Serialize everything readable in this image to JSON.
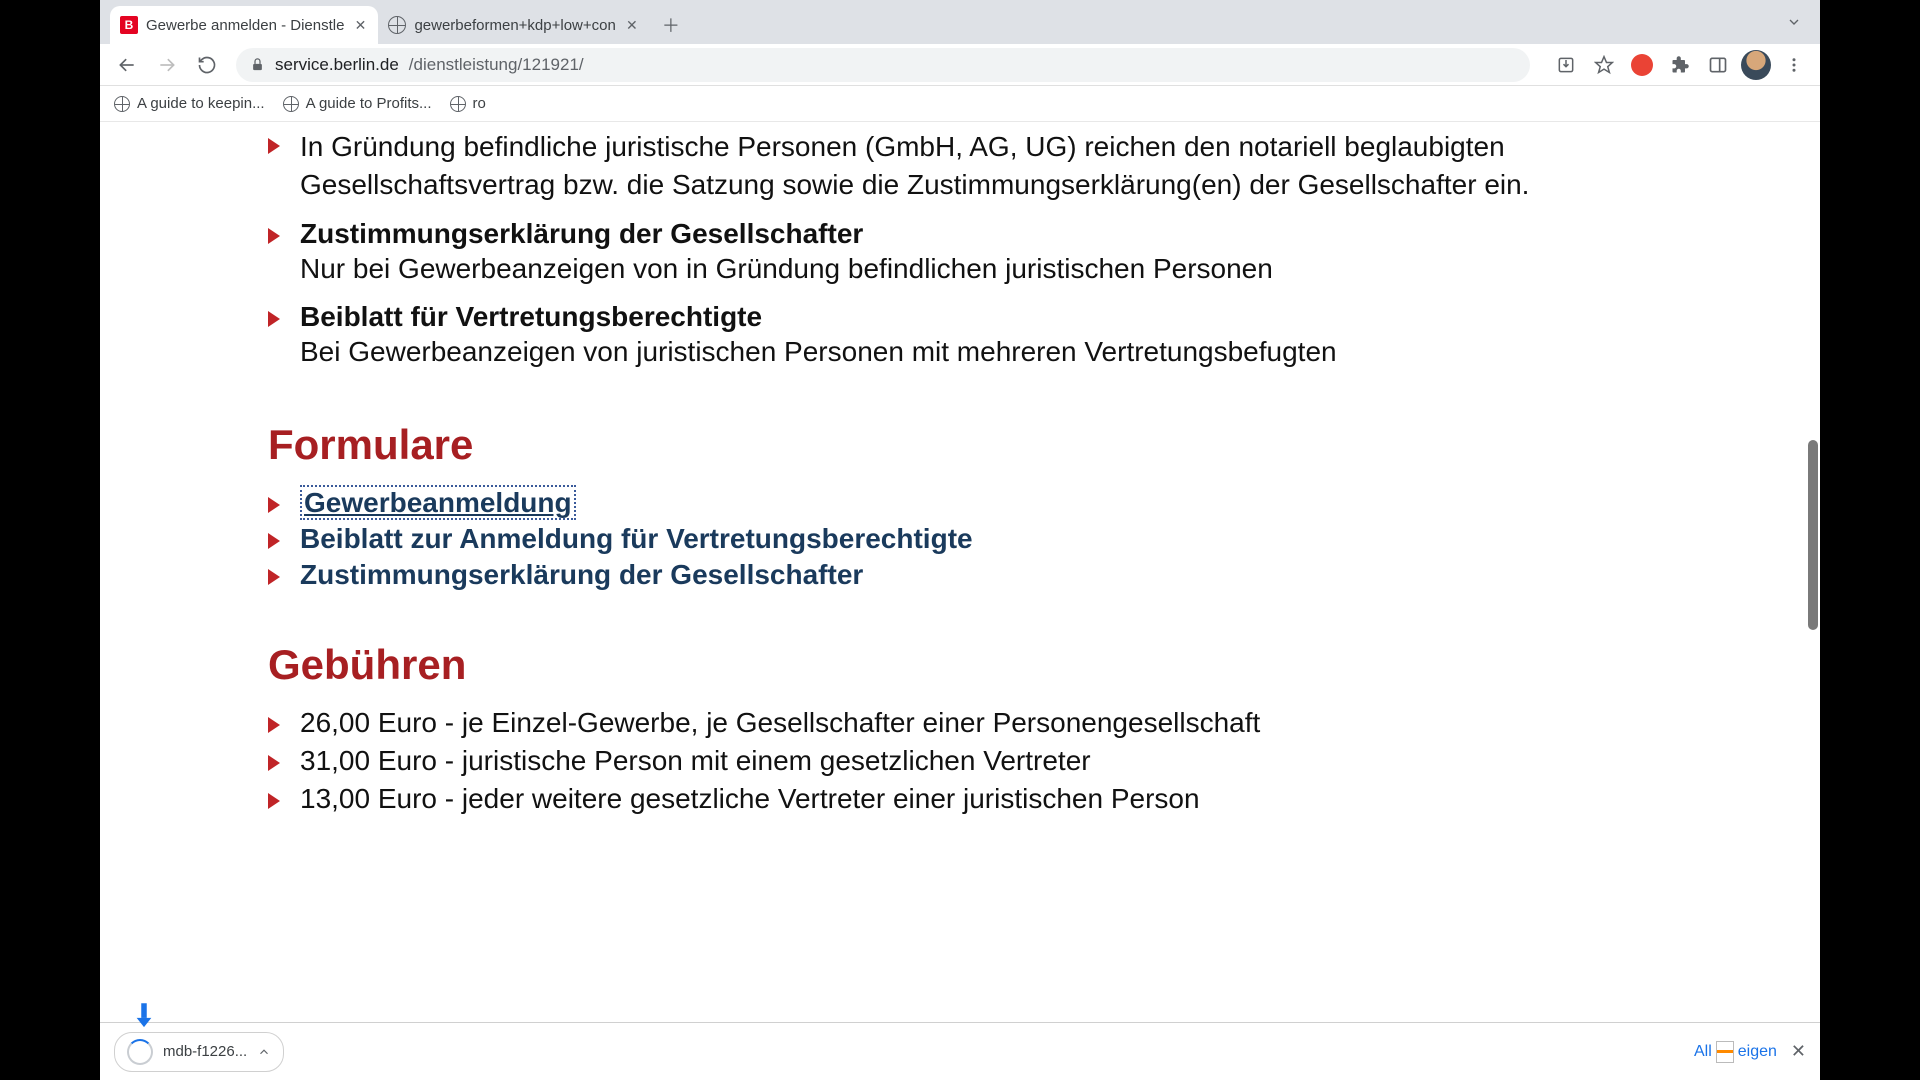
{
  "tabs": [
    {
      "title": "Gewerbe anmelden - Dienstle",
      "favicon": "red-b"
    },
    {
      "title": "gewerbeformen+kdp+low+con",
      "favicon": "globe"
    }
  ],
  "url": {
    "host": "service.berlin.de",
    "path": "/dienstleistung/121921/"
  },
  "bookmarks": [
    {
      "label": "A guide to keepin..."
    },
    {
      "label": "A guide to Profits..."
    },
    {
      "label": "ro"
    }
  ],
  "content": {
    "intro_paragraph": "In Gründung befindliche juristische Personen (GmbH, AG, UG) reichen den notariell beglaubigten Gesellschaftsvertrag bzw. die Satzung sowie die Zustimmungserklärung(en) der Gesellschafter ein.",
    "items": [
      {
        "title": "Zustimmungserklärung der Gesellschafter",
        "desc": "Nur bei Gewerbeanzeigen von in Gründung befindlichen juristischen Personen"
      },
      {
        "title": "Beiblatt für Vertretungsberechtigte",
        "desc": "Bei Gewerbeanzeigen von juristischen Personen mit mehreren Vertretungsbefugten"
      }
    ],
    "section_forms": "Formulare",
    "forms": [
      {
        "label": "Gewerbeanmeldung",
        "visited": true
      },
      {
        "label": "Beiblatt zur Anmeldung für Vertretungsberechtigte",
        "visited": false
      },
      {
        "label": "Zustimmungserklärung der Gesellschafter",
        "visited": false
      }
    ],
    "section_fees": "Gebühren",
    "fees": [
      "26,00 Euro - je Einzel-Gewerbe, je Gesellschafter einer Personengesellschaft",
      "31,00 Euro - juristische Person mit einem gesetzlichen Vertreter",
      "13,00 Euro - jeder weitere gesetzliche Vertreter einer juristischen Person"
    ]
  },
  "download": {
    "filename": "mdb-f1226...",
    "all_pre": "All",
    "all_post": "eigen"
  }
}
